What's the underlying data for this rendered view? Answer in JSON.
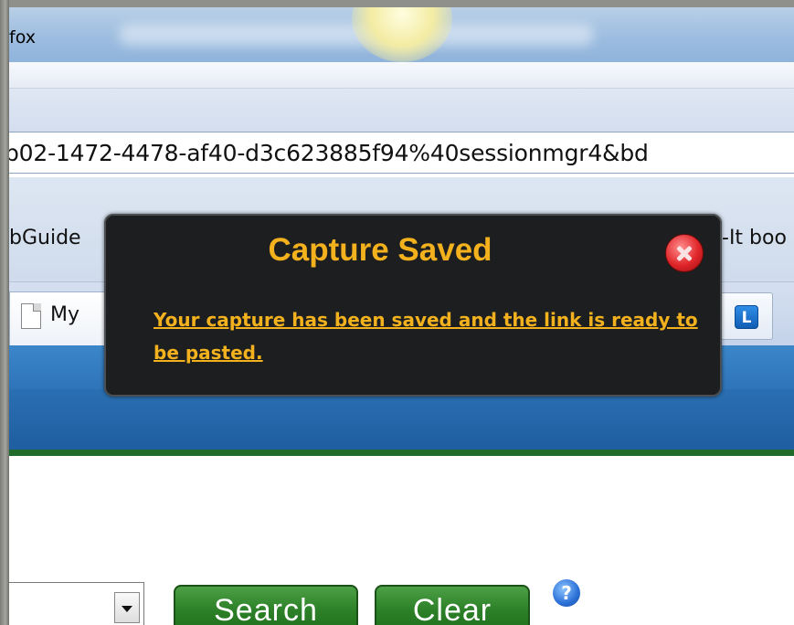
{
  "window": {
    "title": "fox"
  },
  "address_bar": {
    "url": "b02-1472-4478-af40-d3c623885f94%40sessionmgr4&bd"
  },
  "bookmarks_toolbar": {
    "left_item": "bGuide",
    "right_item": "-It boo"
  },
  "tabs": {
    "active_tab_label": "My",
    "extension_button_label": "L"
  },
  "search_form": {
    "search_button": "Search",
    "clear_button": "Clear",
    "help_icon": "help-icon"
  },
  "notification": {
    "title": "Capture Saved",
    "message": "Your capture has been saved and the link is ready to be pasted.",
    "close_icon": "close-icon",
    "colors": {
      "background": "#1d1e20",
      "accent": "#f3b21d",
      "close": "#e0262a"
    }
  }
}
